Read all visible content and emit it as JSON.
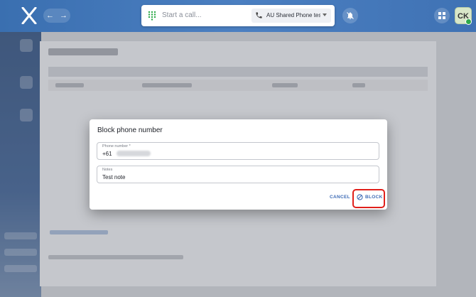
{
  "topbar": {
    "nav_back_icon": "arrow-left-icon",
    "nav_forward_icon": "arrow-right-icon",
    "call_placeholder": "Start a call...",
    "line_selector_value": "AU Shared Phone testi...",
    "avatar_initials": "CK",
    "brand_color": "#3f72b4"
  },
  "dialog": {
    "title": "Block phone number",
    "phone_field": {
      "label": "Phone number *",
      "value": "+61"
    },
    "notes_field": {
      "label": "Notes",
      "value": "Test note"
    },
    "cancel_label": "CANCEL",
    "block_label": "BLOCK",
    "accent_color": "#3f6cb6",
    "highlight_color": "#e0201b"
  },
  "nav_arrows": {
    "back": "←",
    "forward": "→"
  }
}
